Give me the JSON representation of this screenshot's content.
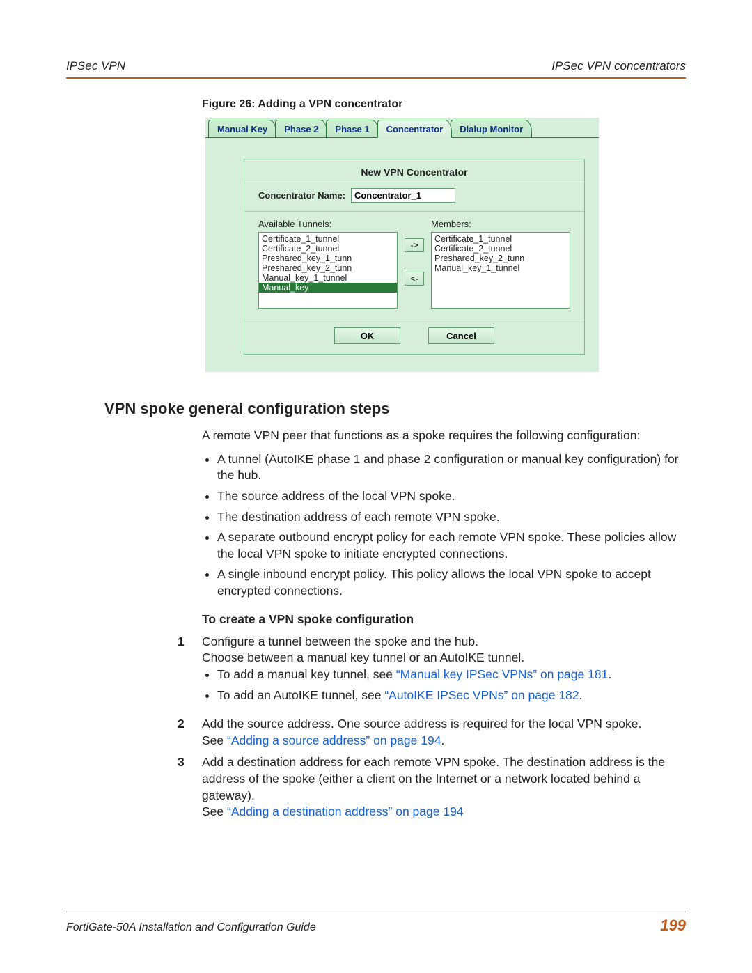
{
  "header": {
    "left": "IPSec VPN",
    "right": "IPSec VPN concentrators"
  },
  "figure": {
    "caption": "Figure 26: Adding a VPN concentrator",
    "tabs": [
      "Manual Key",
      "Phase 2",
      "Phase 1",
      "Concentrator",
      "Dialup Monitor"
    ],
    "active_tab_index": 3,
    "panel_title": "New VPN Concentrator",
    "name_label": "Concentrator Name:",
    "name_value": "Concentrator_1",
    "available_label": "Available Tunnels:",
    "members_label": "Members:",
    "available": [
      "Certificate_1_tunnel",
      "Certificate_2_tunnel",
      "Preshared_key_1_tunn",
      "Preshared_key_2_tunn",
      "Manual_key_1_tunnel",
      "Manual_key"
    ],
    "available_selected_index": 5,
    "members": [
      "Certificate_1_tunnel",
      "Certificate_2_tunnel",
      "Preshared_key_2_tunn",
      "Manual_key_1_tunnel"
    ],
    "add_label": "->",
    "remove_label": "<-",
    "ok_label": "OK",
    "cancel_label": "Cancel"
  },
  "section_heading": "VPN spoke general configuration steps",
  "intro": "A remote VPN peer that functions as a spoke requires the following configuration:",
  "bullets": [
    "A tunnel (AutoIKE phase 1 and phase 2 configuration or manual key configuration) for the hub.",
    "The source address of the local VPN spoke.",
    "The destination address of each remote VPN spoke.",
    "A separate outbound encrypt policy for each remote VPN spoke. These policies allow the local VPN spoke to initiate encrypted connections.",
    "A single inbound encrypt policy. This policy allows the local VPN spoke to accept encrypted connections."
  ],
  "subhead": "To create a VPN spoke configuration",
  "step1": {
    "num": "1",
    "line1": "Configure a tunnel between the spoke and the hub.",
    "line2": "Choose between a manual key tunnel or an AutoIKE tunnel.",
    "sub1_pre": "To add a manual key tunnel, see ",
    "sub1_link": "“Manual key IPSec VPNs” on page 181",
    "sub1_post": ".",
    "sub2_pre": "To add an AutoIKE tunnel, see ",
    "sub2_link": "“AutoIKE IPSec VPNs” on page 182",
    "sub2_post": "."
  },
  "step2": {
    "num": "2",
    "text": "Add the source address. One source address is required for the local VPN spoke.",
    "see_pre": "See ",
    "see_link": "“Adding a source address” on page 194",
    "see_post": "."
  },
  "step3": {
    "num": "3",
    "text": "Add a destination address for each remote VPN spoke. The destination address is the address of the spoke (either a client on the Internet or a network located behind a gateway).",
    "see_pre": "See ",
    "see_link": "“Adding a destination address” on page 194"
  },
  "footer": {
    "title": "FortiGate-50A Installation and Configuration Guide",
    "page": "199"
  }
}
